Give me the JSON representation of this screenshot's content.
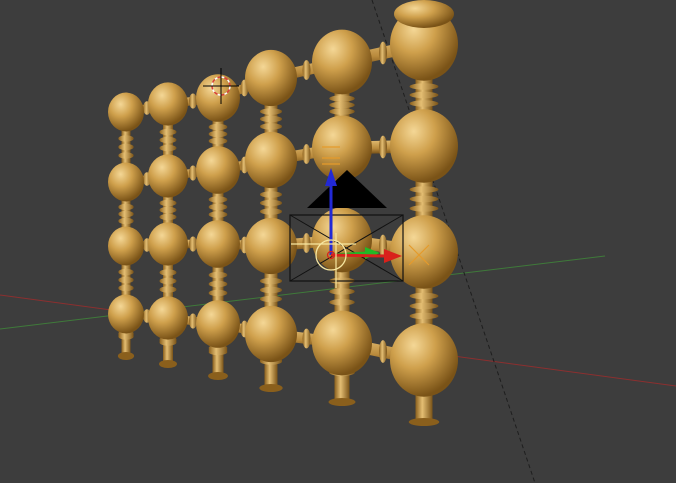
{
  "viewport": {
    "background": "#3d3d3d",
    "axis_x_color": "#8c2f2f",
    "axis_y_color": "#3f7a3a",
    "axis_z_color": "#1e1e1e"
  },
  "model": {
    "name": "baluster-grid",
    "color": "#cfa04c",
    "shadow": "#7a5317",
    "highlight": "#f4d796",
    "columns": 6,
    "rows": 4
  },
  "cursor_3d": {
    "icon": "3d-cursor-icon",
    "colors": [
      "#ffffff",
      "#d9413a"
    ]
  },
  "camera": {
    "icon": "camera-icon",
    "frame_color": "#111111",
    "triangle_color": "#000000"
  },
  "gizmo": {
    "icon": "transform-gizmo-icon",
    "x_color": "#d9211b",
    "y_color": "#22b826",
    "z_color": "#2229d6",
    "pivot_color": "#f7e7a1"
  },
  "lamp": {
    "icon": "lamp-icon",
    "color": "#e59b2b"
  }
}
